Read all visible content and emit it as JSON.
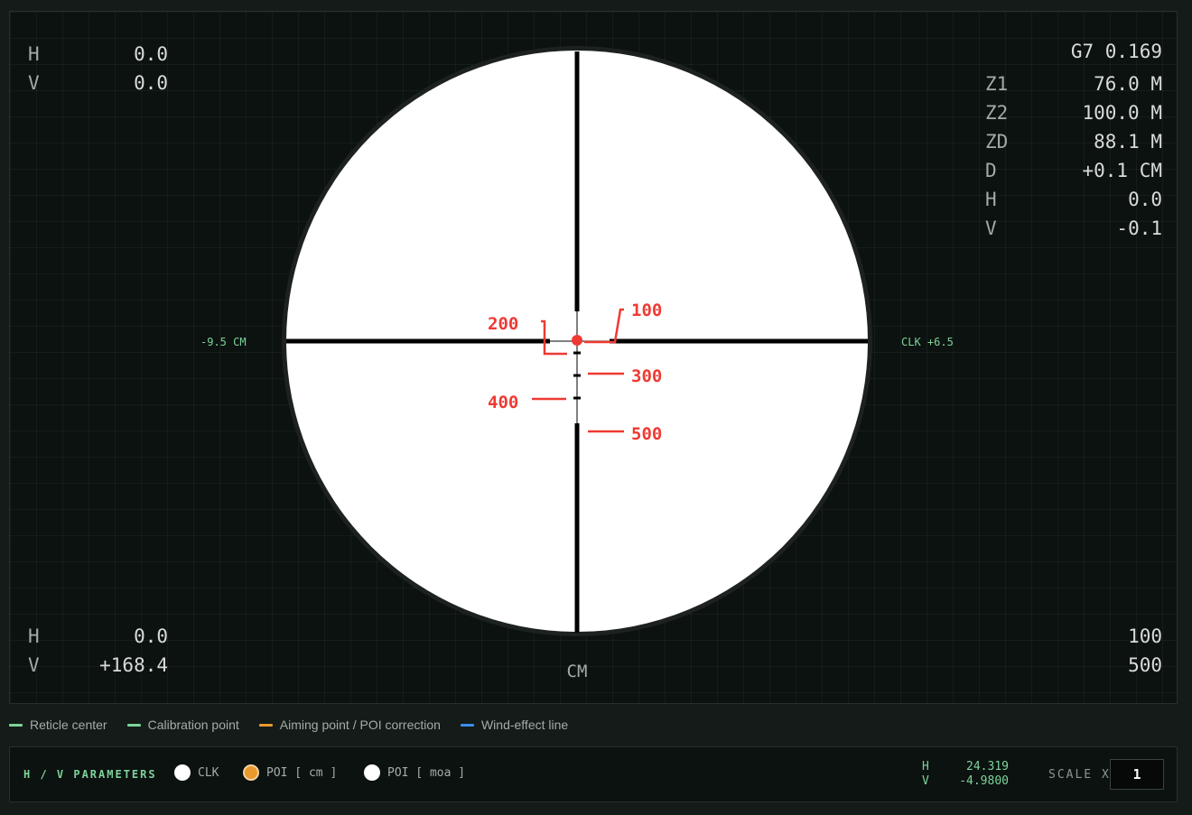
{
  "top_left": {
    "h_label": "H",
    "h_value": "0.0",
    "v_label": "V",
    "v_value": "0.0"
  },
  "top_right": {
    "ballistic": "G7 0.169",
    "rows": [
      {
        "label": "Z1",
        "value": "76.0 M"
      },
      {
        "label": "Z2",
        "value": "100.0 M"
      },
      {
        "label": "ZD",
        "value": "88.1 M"
      },
      {
        "label": "D",
        "value": "+0.1 CM"
      },
      {
        "label": "H",
        "value": "0.0"
      },
      {
        "label": "V",
        "value": "-0.1"
      }
    ]
  },
  "bottom_left": {
    "h_label": "H",
    "h_value": "0.0",
    "v_label": "V",
    "v_value": "+168.4"
  },
  "bottom_right": {
    "line1": "100",
    "line2": "500"
  },
  "scope": {
    "unit_label": "CM",
    "left_label": "-9.5 CM",
    "right_label": "CLK +6.5",
    "distance_marks": [
      "100",
      "200",
      "300",
      "400",
      "500"
    ],
    "colors": {
      "scope_face": "#ffffff",
      "reticle": "#000000",
      "marker": "#ef3a33",
      "text_label": "#7dd39a"
    }
  },
  "legend": [
    {
      "label": "Reticle center",
      "color": "#7dd39a"
    },
    {
      "label": "Calibration point",
      "color": "#7dd39a"
    },
    {
      "label": "Aiming point / POI correction",
      "color": "#e99a2c"
    },
    {
      "label": "Wind-effect line",
      "color": "#3b8df0"
    }
  ],
  "params": {
    "title": "H / V PARAMETERS",
    "options": [
      {
        "label": "CLK",
        "selected": false
      },
      {
        "label": "POI [ cm ]",
        "selected": true
      },
      {
        "label": "POI [ moa ]",
        "selected": false
      }
    ],
    "live_h_label": "H",
    "live_h_value": "24.319",
    "live_v_label": "V",
    "live_v_value": "-4.9800",
    "scale_label": "SCALE X",
    "scale_value": "1"
  }
}
